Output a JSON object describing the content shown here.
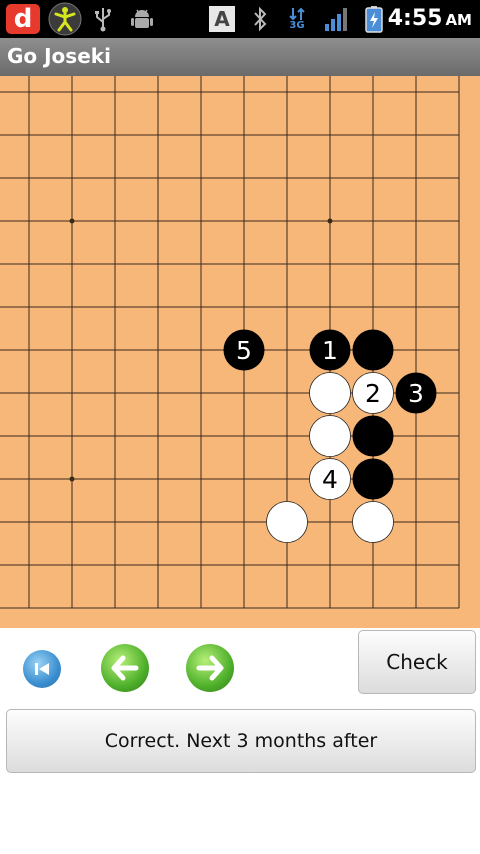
{
  "status_bar": {
    "time": "4:55",
    "ampm": "AM",
    "app_icon_letter": "d",
    "keyboard_letter": "A",
    "network_label": "3G",
    "icons": [
      "d-app-icon",
      "dancer-icon",
      "usb-icon",
      "android-debug-icon",
      "keyboard-a-icon",
      "bluetooth-icon",
      "3g-icon",
      "signal-icon",
      "battery-charging-icon"
    ]
  },
  "app": {
    "title": "Go Joseki"
  },
  "board": {
    "stones": [
      {
        "color": "black",
        "label": "1",
        "col": 7,
        "row": 6
      },
      {
        "color": "black",
        "label": "",
        "col": 8,
        "row": 6
      },
      {
        "color": "black",
        "label": "5",
        "col": 5,
        "row": 6
      },
      {
        "color": "white",
        "label": "",
        "col": 7,
        "row": 7
      },
      {
        "color": "white",
        "label": "2",
        "col": 8,
        "row": 7
      },
      {
        "color": "black",
        "label": "3",
        "col": 9,
        "row": 7
      },
      {
        "color": "white",
        "label": "",
        "col": 7,
        "row": 8
      },
      {
        "color": "black",
        "label": "",
        "col": 8,
        "row": 8
      },
      {
        "color": "white",
        "label": "4",
        "col": 7,
        "row": 9
      },
      {
        "color": "black",
        "label": "",
        "col": 8,
        "row": 9
      },
      {
        "color": "white",
        "label": "",
        "col": 6,
        "row": 10
      },
      {
        "color": "white",
        "label": "",
        "col": 8,
        "row": 10
      }
    ],
    "colors": {
      "board": "#f6b778",
      "line": "#3a2a1a",
      "black": "#000000",
      "white": "#ffffff"
    }
  },
  "controls": {
    "check_label": "Check",
    "message": "Correct. Next 3 months after",
    "icons": [
      "skip-to-start-icon",
      "back-arrow-icon",
      "forward-arrow-icon"
    ]
  }
}
